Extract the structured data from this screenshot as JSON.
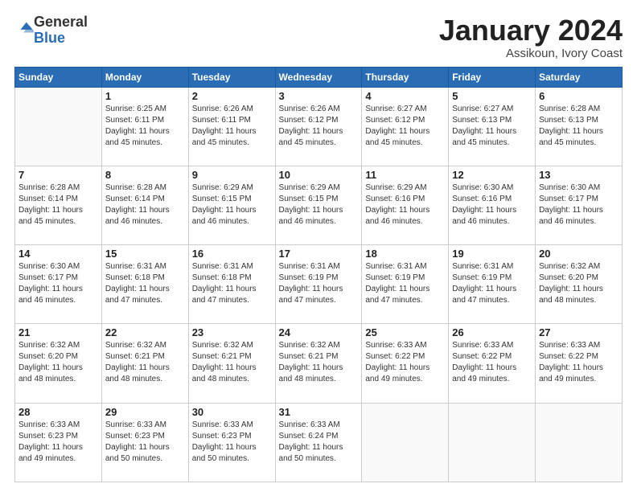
{
  "header": {
    "logo_general": "General",
    "logo_blue": "Blue",
    "month_title": "January 2024",
    "location": "Assikoun, Ivory Coast"
  },
  "weekdays": [
    "Sunday",
    "Monday",
    "Tuesday",
    "Wednesday",
    "Thursday",
    "Friday",
    "Saturday"
  ],
  "weeks": [
    [
      {
        "day": "",
        "sunrise": "",
        "sunset": "",
        "daylight": ""
      },
      {
        "day": "1",
        "sunrise": "Sunrise: 6:25 AM",
        "sunset": "Sunset: 6:11 PM",
        "daylight": "Daylight: 11 hours and 45 minutes."
      },
      {
        "day": "2",
        "sunrise": "Sunrise: 6:26 AM",
        "sunset": "Sunset: 6:11 PM",
        "daylight": "Daylight: 11 hours and 45 minutes."
      },
      {
        "day": "3",
        "sunrise": "Sunrise: 6:26 AM",
        "sunset": "Sunset: 6:12 PM",
        "daylight": "Daylight: 11 hours and 45 minutes."
      },
      {
        "day": "4",
        "sunrise": "Sunrise: 6:27 AM",
        "sunset": "Sunset: 6:12 PM",
        "daylight": "Daylight: 11 hours and 45 minutes."
      },
      {
        "day": "5",
        "sunrise": "Sunrise: 6:27 AM",
        "sunset": "Sunset: 6:13 PM",
        "daylight": "Daylight: 11 hours and 45 minutes."
      },
      {
        "day": "6",
        "sunrise": "Sunrise: 6:28 AM",
        "sunset": "Sunset: 6:13 PM",
        "daylight": "Daylight: 11 hours and 45 minutes."
      }
    ],
    [
      {
        "day": "7",
        "sunrise": "Sunrise: 6:28 AM",
        "sunset": "Sunset: 6:14 PM",
        "daylight": "Daylight: 11 hours and 45 minutes."
      },
      {
        "day": "8",
        "sunrise": "Sunrise: 6:28 AM",
        "sunset": "Sunset: 6:14 PM",
        "daylight": "Daylight: 11 hours and 46 minutes."
      },
      {
        "day": "9",
        "sunrise": "Sunrise: 6:29 AM",
        "sunset": "Sunset: 6:15 PM",
        "daylight": "Daylight: 11 hours and 46 minutes."
      },
      {
        "day": "10",
        "sunrise": "Sunrise: 6:29 AM",
        "sunset": "Sunset: 6:15 PM",
        "daylight": "Daylight: 11 hours and 46 minutes."
      },
      {
        "day": "11",
        "sunrise": "Sunrise: 6:29 AM",
        "sunset": "Sunset: 6:16 PM",
        "daylight": "Daylight: 11 hours and 46 minutes."
      },
      {
        "day": "12",
        "sunrise": "Sunrise: 6:30 AM",
        "sunset": "Sunset: 6:16 PM",
        "daylight": "Daylight: 11 hours and 46 minutes."
      },
      {
        "day": "13",
        "sunrise": "Sunrise: 6:30 AM",
        "sunset": "Sunset: 6:17 PM",
        "daylight": "Daylight: 11 hours and 46 minutes."
      }
    ],
    [
      {
        "day": "14",
        "sunrise": "Sunrise: 6:30 AM",
        "sunset": "Sunset: 6:17 PM",
        "daylight": "Daylight: 11 hours and 46 minutes."
      },
      {
        "day": "15",
        "sunrise": "Sunrise: 6:31 AM",
        "sunset": "Sunset: 6:18 PM",
        "daylight": "Daylight: 11 hours and 47 minutes."
      },
      {
        "day": "16",
        "sunrise": "Sunrise: 6:31 AM",
        "sunset": "Sunset: 6:18 PM",
        "daylight": "Daylight: 11 hours and 47 minutes."
      },
      {
        "day": "17",
        "sunrise": "Sunrise: 6:31 AM",
        "sunset": "Sunset: 6:19 PM",
        "daylight": "Daylight: 11 hours and 47 minutes."
      },
      {
        "day": "18",
        "sunrise": "Sunrise: 6:31 AM",
        "sunset": "Sunset: 6:19 PM",
        "daylight": "Daylight: 11 hours and 47 minutes."
      },
      {
        "day": "19",
        "sunrise": "Sunrise: 6:31 AM",
        "sunset": "Sunset: 6:19 PM",
        "daylight": "Daylight: 11 hours and 47 minutes."
      },
      {
        "day": "20",
        "sunrise": "Sunrise: 6:32 AM",
        "sunset": "Sunset: 6:20 PM",
        "daylight": "Daylight: 11 hours and 48 minutes."
      }
    ],
    [
      {
        "day": "21",
        "sunrise": "Sunrise: 6:32 AM",
        "sunset": "Sunset: 6:20 PM",
        "daylight": "Daylight: 11 hours and 48 minutes."
      },
      {
        "day": "22",
        "sunrise": "Sunrise: 6:32 AM",
        "sunset": "Sunset: 6:21 PM",
        "daylight": "Daylight: 11 hours and 48 minutes."
      },
      {
        "day": "23",
        "sunrise": "Sunrise: 6:32 AM",
        "sunset": "Sunset: 6:21 PM",
        "daylight": "Daylight: 11 hours and 48 minutes."
      },
      {
        "day": "24",
        "sunrise": "Sunrise: 6:32 AM",
        "sunset": "Sunset: 6:21 PM",
        "daylight": "Daylight: 11 hours and 48 minutes."
      },
      {
        "day": "25",
        "sunrise": "Sunrise: 6:33 AM",
        "sunset": "Sunset: 6:22 PM",
        "daylight": "Daylight: 11 hours and 49 minutes."
      },
      {
        "day": "26",
        "sunrise": "Sunrise: 6:33 AM",
        "sunset": "Sunset: 6:22 PM",
        "daylight": "Daylight: 11 hours and 49 minutes."
      },
      {
        "day": "27",
        "sunrise": "Sunrise: 6:33 AM",
        "sunset": "Sunset: 6:22 PM",
        "daylight": "Daylight: 11 hours and 49 minutes."
      }
    ],
    [
      {
        "day": "28",
        "sunrise": "Sunrise: 6:33 AM",
        "sunset": "Sunset: 6:23 PM",
        "daylight": "Daylight: 11 hours and 49 minutes."
      },
      {
        "day": "29",
        "sunrise": "Sunrise: 6:33 AM",
        "sunset": "Sunset: 6:23 PM",
        "daylight": "Daylight: 11 hours and 50 minutes."
      },
      {
        "day": "30",
        "sunrise": "Sunrise: 6:33 AM",
        "sunset": "Sunset: 6:23 PM",
        "daylight": "Daylight: 11 hours and 50 minutes."
      },
      {
        "day": "31",
        "sunrise": "Sunrise: 6:33 AM",
        "sunset": "Sunset: 6:24 PM",
        "daylight": "Daylight: 11 hours and 50 minutes."
      },
      {
        "day": "",
        "sunrise": "",
        "sunset": "",
        "daylight": ""
      },
      {
        "day": "",
        "sunrise": "",
        "sunset": "",
        "daylight": ""
      },
      {
        "day": "",
        "sunrise": "",
        "sunset": "",
        "daylight": ""
      }
    ]
  ]
}
